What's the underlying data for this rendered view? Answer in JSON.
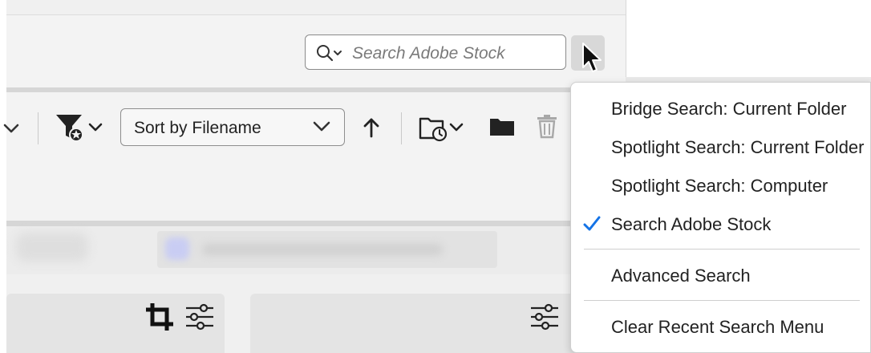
{
  "search": {
    "placeholder": "Search Adobe Stock"
  },
  "toolbar": {
    "sort_label": "Sort by Filename"
  },
  "search_menu": {
    "items": [
      {
        "label": "Bridge Search: Current Folder",
        "checked": false
      },
      {
        "label": "Spotlight Search: Current Folder",
        "checked": false
      },
      {
        "label": "Spotlight Search: Computer",
        "checked": false
      },
      {
        "label": "Search Adobe Stock",
        "checked": true
      },
      {
        "label": "Advanced Search",
        "checked": false
      },
      {
        "label": "Clear Recent Search Menu",
        "checked": false
      }
    ]
  },
  "icons": {
    "search": "search-icon",
    "menu_chevron": "chevron-down-icon",
    "filter": "filter-favorites-icon",
    "sort_direction": "arrow-up-icon",
    "recent_folder": "recent-folder-icon",
    "new_folder": "folder-icon",
    "delete": "trash-icon",
    "crop": "crop-icon",
    "adjustments": "sliders-icon",
    "selected_check": "checkmark-icon"
  },
  "colors": {
    "accent_check": "#1473e6",
    "menu_background": "#ffffff",
    "panel_background": "#f3f3f3"
  }
}
